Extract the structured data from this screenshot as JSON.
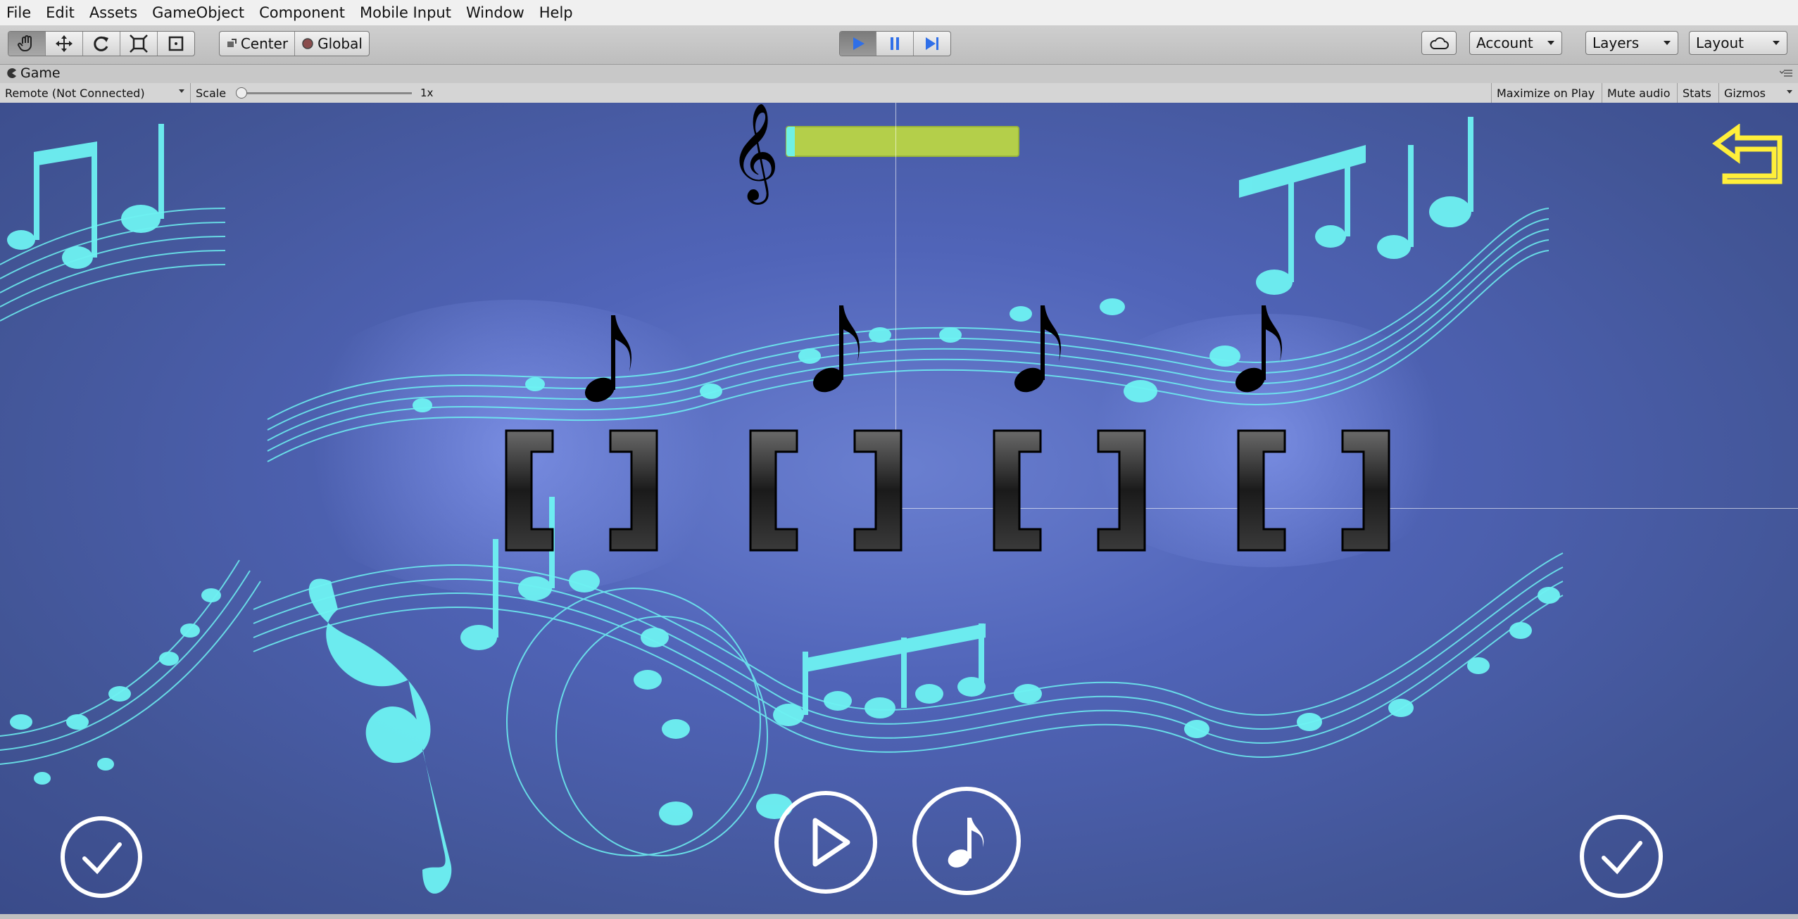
{
  "menu": [
    "File",
    "Edit",
    "Assets",
    "GameObject",
    "Component",
    "Mobile Input",
    "Window",
    "Help"
  ],
  "toolbar": {
    "pivot_label": "Center",
    "space_label": "Global",
    "account_label": "Account",
    "layers_label": "Layers",
    "layout_label": "Layout"
  },
  "game_tab": {
    "title": "Game",
    "display_label": "Remote (Not Connected)",
    "scale_label": "Scale",
    "scale_value": "1x",
    "maximize_label": "Maximize on Play",
    "mute_label": "Mute audio",
    "stats_label": "Stats",
    "gizmos_label": "Gizmos"
  },
  "game": {
    "progress_fraction": 0.03,
    "slot_count": 4,
    "colors": {
      "background": "#4a5ea8",
      "notes": "#6ef2f2",
      "meter": "#b4cf4a",
      "back_arrow": "#ffef3a"
    },
    "icons": [
      "treble-clef-icon",
      "eighth-note-icon",
      "back-arrow-icon",
      "checkmark-icon",
      "play-icon",
      "music-note-icon"
    ]
  }
}
